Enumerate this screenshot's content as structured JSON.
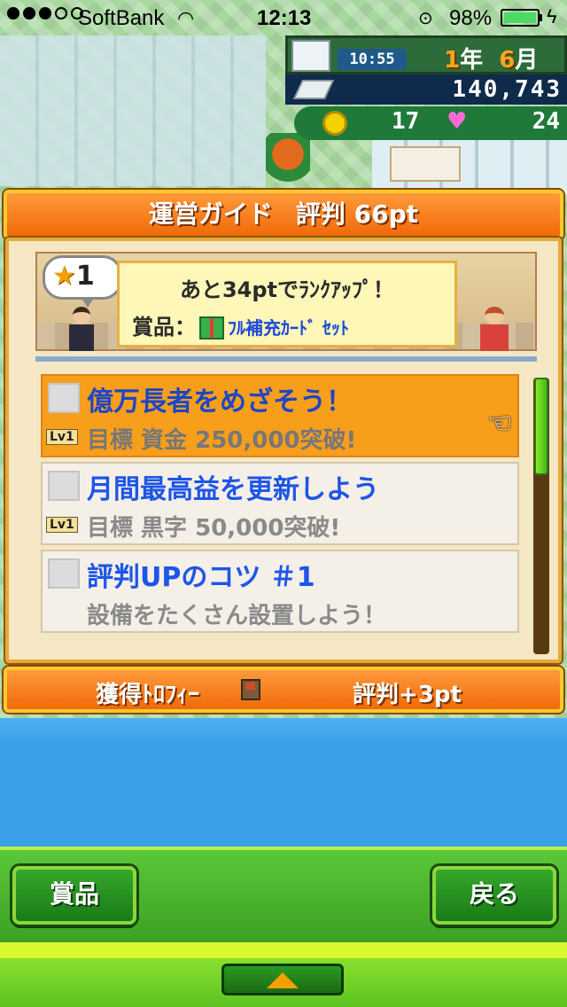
{
  "status_bar": {
    "carrier": "SoftBank",
    "time": "12:13",
    "battery_percent": "98%"
  },
  "hud": {
    "clock": "10:55",
    "year_num": "1",
    "year_unit": "年",
    "month_num": "6",
    "month_unit": "月",
    "money": "140,743",
    "coins": "17",
    "hearts": "24"
  },
  "header": {
    "title": "運営ガイド",
    "reputation": "評判 66pt"
  },
  "banner": {
    "rank_badge": "1",
    "message": "あと34ptでﾗﾝｸｱｯﾌﾟ！",
    "prize_label": "賞品：",
    "prize_name": "ﾌﾙ補充ｶｰﾄﾞ ｾｯﾄ"
  },
  "guide_items": [
    {
      "title": "億万長者をめざそう！",
      "level": "Lv1",
      "description": "目標 資金 250,000突破!"
    },
    {
      "title": "月間最高益を更新しよう",
      "level": "Lv1",
      "description": "目標 黒字 50,000突破!"
    },
    {
      "title": "評判UPのコツ ＃1",
      "description": "設備をたくさん設置しよう！"
    }
  ],
  "trophy_bar": {
    "label": "獲得ﾄﾛﾌｨｰ",
    "reward": "評判+3pt"
  },
  "buttons": {
    "prize": "賞品",
    "back": "戻る"
  },
  "colors": {
    "accent_orange": "#f06a08",
    "selected_item": "#f79e1b",
    "title_blue": "#1d55e8",
    "button_green": "#1a7a18"
  },
  "scroll_position_fraction": 0.0
}
